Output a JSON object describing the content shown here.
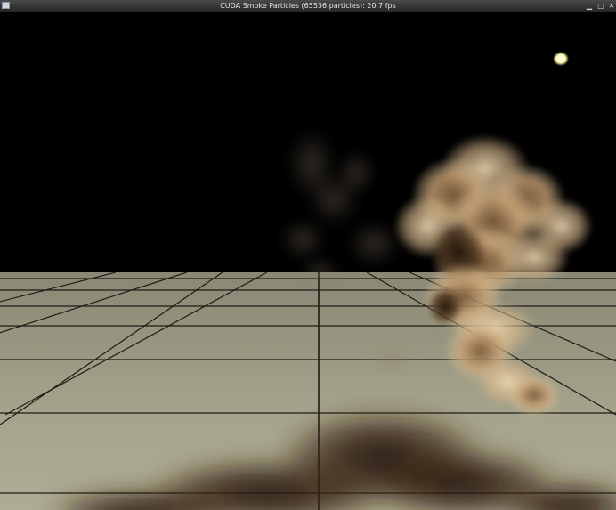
{
  "window": {
    "title": "CUDA Smoke Particles (65536 particles): 20.7 fps",
    "icons": {
      "app": "app-window-icon",
      "minimize": "minimize-icon",
      "maximize": "maximize-icon",
      "close": "close-icon"
    }
  },
  "scene": {
    "sky_color": "#000000",
    "floor_color": "#8e8c77",
    "grid_line_color": "#1c1c16",
    "light_color": "#fff6b0",
    "smoke_color": "#c8a274"
  }
}
